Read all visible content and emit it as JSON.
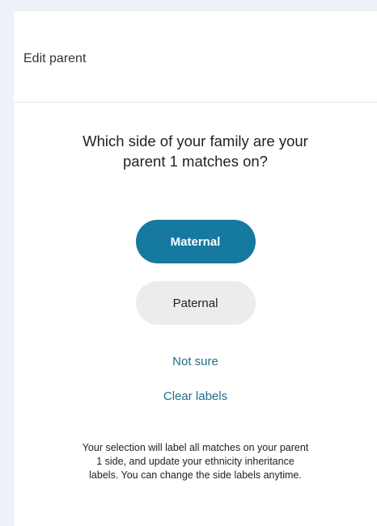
{
  "panel": {
    "title": "Edit parent"
  },
  "question": {
    "line1": "Which side of your family are your",
    "line2": "parent 1 matches on?"
  },
  "options": {
    "maternal_label": "Maternal",
    "paternal_label": "Paternal",
    "selected": "Maternal"
  },
  "links": {
    "not_sure": "Not sure",
    "clear_labels": "Clear labels"
  },
  "footnote": {
    "line1": "Your selection will label all matches on your parent",
    "line2": "1 side, and update your ethnicity inheritance",
    "line3": "labels. You can change the side labels anytime."
  },
  "colors": {
    "page_background": "#edf1f8",
    "accent": "#1579a0",
    "link": "#1f6d8c",
    "unselected_button": "#ececec"
  }
}
